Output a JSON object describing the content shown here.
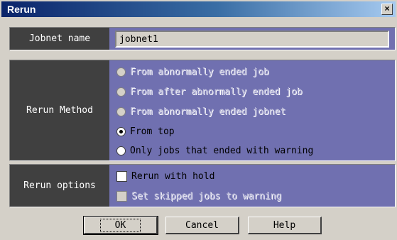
{
  "window": {
    "title": "Rerun",
    "close_glyph": "×"
  },
  "jobnet": {
    "label": "Jobnet name",
    "value": "jobnet1"
  },
  "rerun_method": {
    "label": "Rerun Method",
    "options": [
      {
        "label": "From abnormally ended job",
        "enabled": false,
        "selected": false
      },
      {
        "label": "From after abnormally ended job",
        "enabled": false,
        "selected": false
      },
      {
        "label": "From abnormally ended jobnet",
        "enabled": false,
        "selected": false
      },
      {
        "label": "From top",
        "enabled": true,
        "selected": true
      },
      {
        "label": "Only jobs that ended with warning",
        "enabled": true,
        "selected": false
      }
    ]
  },
  "rerun_options": {
    "label": "Rerun options",
    "options": [
      {
        "label": "Rerun with hold",
        "enabled": true,
        "checked": false
      },
      {
        "label": "Set skipped jobs to warning",
        "enabled": false,
        "checked": false
      }
    ]
  },
  "buttons": {
    "ok": "OK",
    "cancel": "Cancel",
    "help": "Help"
  },
  "colors": {
    "label_bg": "#404040",
    "value_bg": "#7070b0",
    "dialog_bg": "#d4d0c8",
    "title_start": "#0a246a",
    "title_end": "#a6caf0"
  }
}
